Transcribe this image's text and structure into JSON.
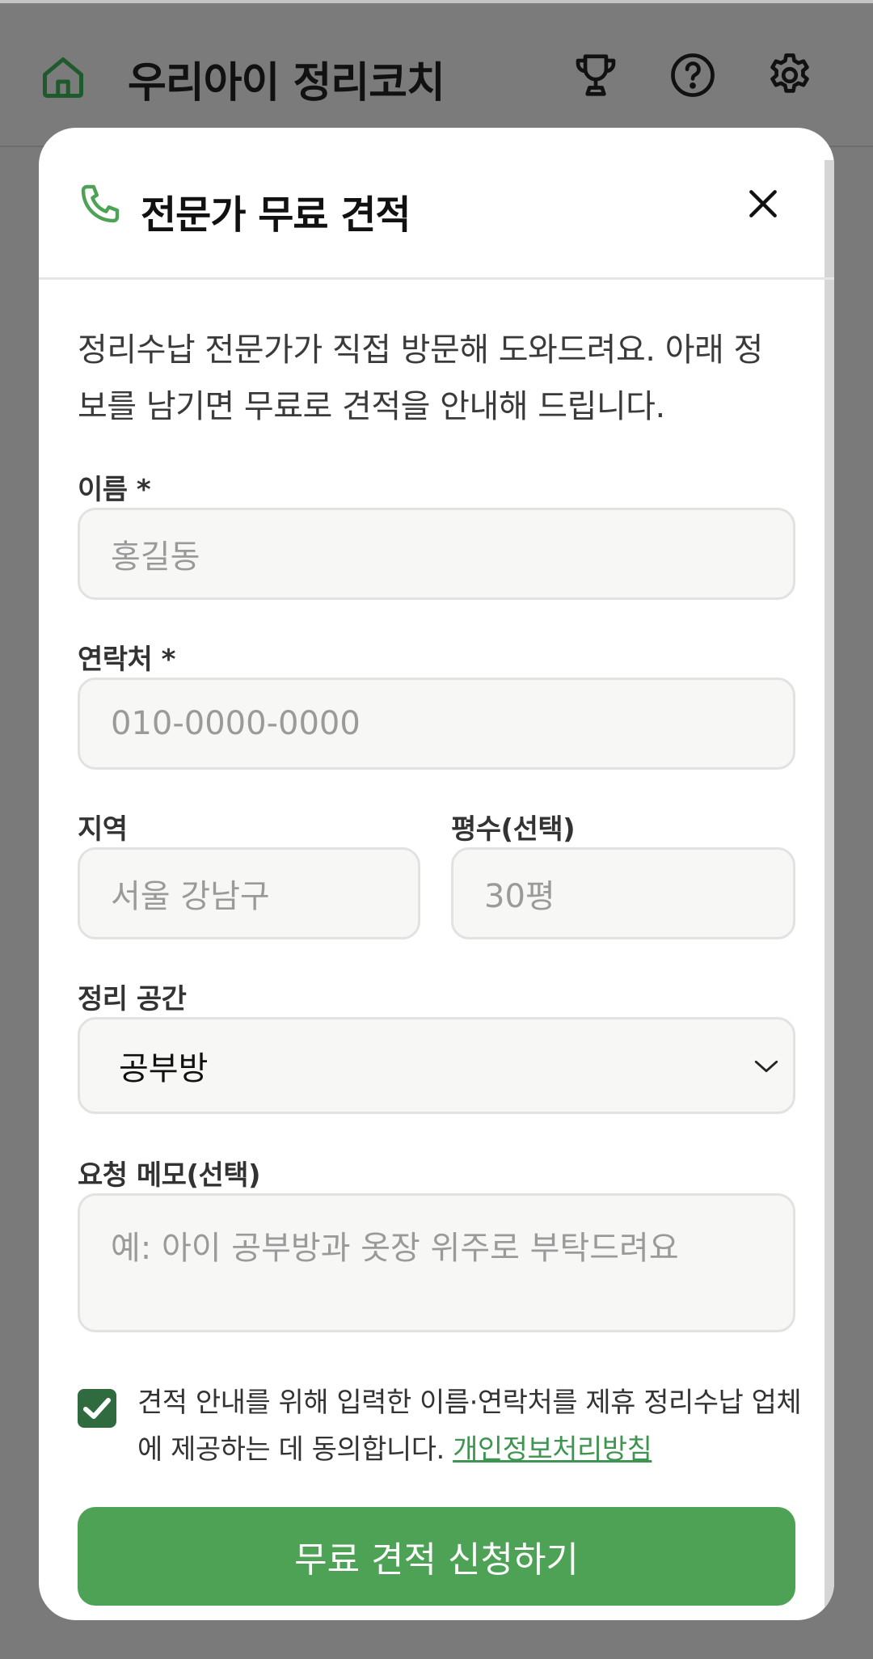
{
  "app": {
    "title": "우리아이 정리코치"
  },
  "header_icons": [
    "home-icon",
    "trophy-icon",
    "help-icon",
    "settings-icon"
  ],
  "modal": {
    "title": "전문가 무료 견적",
    "intro": "정리수납 전문가가 직접 방문해 도와드려요. 아래 정보를 남기면 무료로 견적을 안내해 드립니다.",
    "name": {
      "label": "이름 *",
      "placeholder": "홍길동"
    },
    "phone": {
      "label": "연락처 *",
      "placeholder": "010-0000-0000"
    },
    "region": {
      "label": "지역",
      "placeholder": "서울 강남구"
    },
    "area": {
      "label": "평수(선택)",
      "placeholder": "30평"
    },
    "space": {
      "label": "정리 공간",
      "value": "공부방"
    },
    "memo": {
      "label": "요청 메모(선택)",
      "placeholder": "예: 아이 공부방과 옷장 위주로 부탁드려요"
    },
    "consent": {
      "checked": true,
      "text": "견적 안내를 위해 입력한 이름·연락처를 제휴 정리수납 업체에 제공하는 데 동의합니다.",
      "link": "개인정보처리방침"
    },
    "submit_label": "무료 견적 신청하기"
  },
  "colors": {
    "accent": "#4ea255",
    "accent_dark": "#2f6b3f",
    "overlay": "#7a7a7a"
  }
}
